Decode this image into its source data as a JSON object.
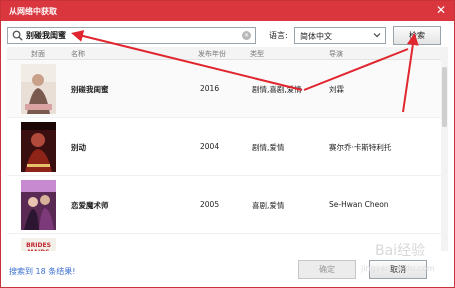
{
  "window": {
    "title": "从网络中获取",
    "close_glyph": "✕",
    "accent_color": "#d9363e"
  },
  "search": {
    "value": "别碰我闺蜜",
    "clear_glyph": "✕"
  },
  "language": {
    "label": "语言:",
    "selected": "简体中文"
  },
  "search_button_label": "检索",
  "table": {
    "headers": [
      "封面",
      "名称",
      "发布年份",
      "类型",
      "导演"
    ],
    "rows": [
      {
        "name": "别碰我闺蜜",
        "year": "2016",
        "genre": "剧情,喜剧,爱情",
        "director": "刘霖"
      },
      {
        "name": "别动",
        "year": "2004",
        "genre": "剧情,爱情",
        "director": "赛尔乔·卡斯特利托"
      },
      {
        "name": "恋爱魔术师",
        "year": "2005",
        "genre": "喜剧,爱情",
        "director": "Se-Hwan Cheon"
      },
      {
        "name": "",
        "year": "",
        "genre": "",
        "director": "",
        "poster_text": "BRIDES MAIDS"
      }
    ]
  },
  "footer": {
    "result_text": "搜索到 18 条结果!",
    "ok_label": "确定",
    "cancel_label": "取消"
  },
  "watermark": {
    "text": "Bai经验",
    "url": "jingyan.baidu.com"
  },
  "annotation_color": "#e0262e"
}
